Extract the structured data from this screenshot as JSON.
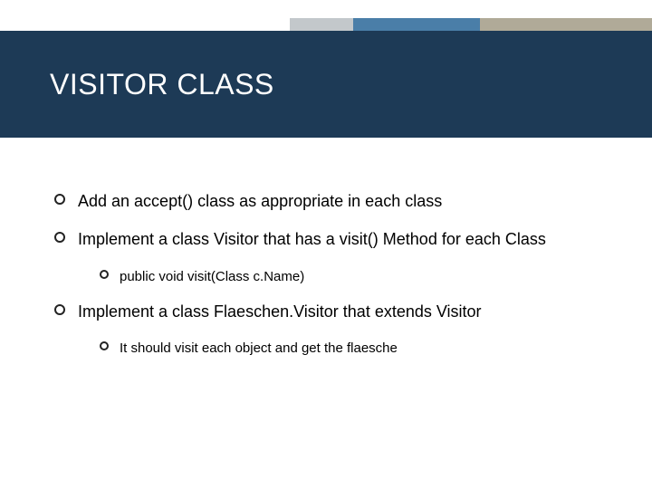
{
  "title": "VISITOR CLASS",
  "bullets": [
    {
      "level": 1,
      "text": "Add an accept() class as appropriate in each class"
    },
    {
      "level": 1,
      "text": "Implement a class Visitor that has a visit() Method for each Class"
    },
    {
      "level": 2,
      "text": "public void visit(Class c.Name)"
    },
    {
      "level": 1,
      "text": "Implement a class Flaeschen.Visitor that extends Visitor"
    },
    {
      "level": 2,
      "text": "It should visit each object and get the flaesche"
    }
  ],
  "accent_colors": {
    "gray": "#c3c8cb",
    "blue": "#4a7ea8",
    "taupe": "#b0aa98",
    "title_band": "#1d3a56"
  }
}
